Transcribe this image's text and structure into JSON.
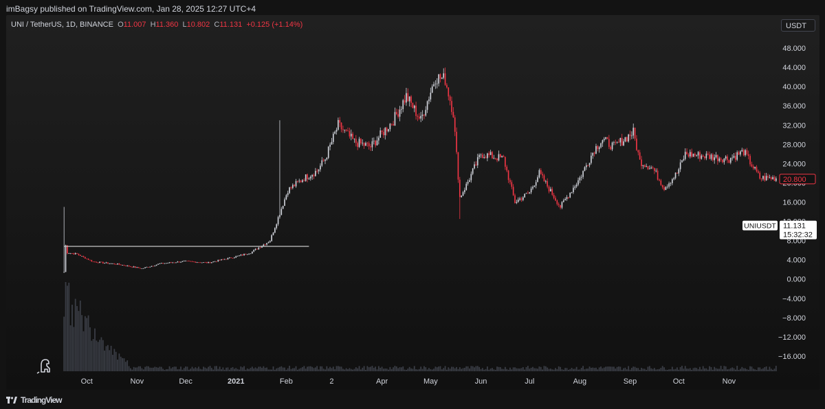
{
  "header": {
    "published_line": "imBagsy published on TradingView.com, Jan 28, 2025 12:27 UTC+4"
  },
  "legend": {
    "symbol": "UNI / TetherUS, 1D, BINANCE",
    "open_label": "O",
    "open": "11.007",
    "high_label": "H",
    "high": "11.360",
    "low_label": "L",
    "low": "10.802",
    "close_label": "C",
    "close": "11.131",
    "change": "+0.125 (+1.14%)"
  },
  "currency_button": "USDT",
  "footer": {
    "brand": "TradingView",
    "logo_icon": "tradingview-logo-icon"
  },
  "colors": {
    "up": "#d1d4dc",
    "down": "#f23645",
    "price_tag_border": "#f23645",
    "volume": "#3a3d45",
    "horizontal_line": "#c8c8c8"
  },
  "chart_data": {
    "type": "candlestick",
    "symbol": "UNIUSDT",
    "timeframe": "1D",
    "y_axis": {
      "ticks": [
        "48.000",
        "44.000",
        "40.000",
        "36.000",
        "32.000",
        "28.000",
        "24.000",
        "20.000",
        "16.000",
        "12.000",
        "8.000",
        "4.000",
        "0.000",
        "−4.000",
        "−8.000",
        "−12.000",
        "−16.000"
      ],
      "tick_values": [
        48,
        44,
        40,
        36,
        32,
        28,
        24,
        20,
        16,
        12,
        8,
        4,
        0,
        -4,
        -8,
        -12,
        -16
      ],
      "ylim": [
        -19,
        50
      ]
    },
    "x_axis": {
      "ticks": [
        "Oct",
        "Nov",
        "Dec",
        "2021",
        "Feb",
        "2",
        "Apr",
        "May",
        "Jun",
        "Jul",
        "Aug",
        "Sep",
        "Oct",
        "Nov"
      ],
      "bold": [
        "2021"
      ]
    },
    "series_start": "2020-09-17",
    "series_end": "2021-11-30",
    "price_path_anchors": [
      [
        "2020-09-17",
        1.5
      ],
      [
        "2020-09-18",
        7.0
      ],
      [
        "2020-09-19",
        5.5
      ],
      [
        "2020-09-25",
        5.2
      ],
      [
        "2020-10-05",
        3.6
      ],
      [
        "2020-10-20",
        3.1
      ],
      [
        "2020-11-04",
        2.2
      ],
      [
        "2020-11-15",
        3.2
      ],
      [
        "2020-11-30",
        3.7
      ],
      [
        "2020-12-15",
        3.4
      ],
      [
        "2020-12-31",
        4.6
      ],
      [
        "2021-01-10",
        5.5
      ],
      [
        "2021-01-22",
        8.0
      ],
      [
        "2021-02-02",
        18.5
      ],
      [
        "2021-02-12",
        21.0
      ],
      [
        "2021-02-20",
        22.5
      ],
      [
        "2021-02-25",
        25.0
      ],
      [
        "2021-03-05",
        32.0
      ],
      [
        "2021-03-15",
        28.5
      ],
      [
        "2021-03-25",
        27.5
      ],
      [
        "2021-04-08",
        33.0
      ],
      [
        "2021-04-16",
        38.0
      ],
      [
        "2021-04-25",
        33.0
      ],
      [
        "2021-05-04",
        42.0
      ],
      [
        "2021-05-10",
        41.5
      ],
      [
        "2021-05-15",
        34.5
      ],
      [
        "2021-05-19",
        17.0
      ],
      [
        "2021-05-23",
        19.5
      ],
      [
        "2021-06-01",
        26.0
      ],
      [
        "2021-06-15",
        25.0
      ],
      [
        "2021-06-22",
        16.0
      ],
      [
        "2021-07-01",
        18.0
      ],
      [
        "2021-07-07",
        22.0
      ],
      [
        "2021-07-20",
        15.0
      ],
      [
        "2021-08-01",
        21.0
      ],
      [
        "2021-08-10",
        27.0
      ],
      [
        "2021-08-15",
        29.0
      ],
      [
        "2021-08-22",
        27.5
      ],
      [
        "2021-09-03",
        30.5
      ],
      [
        "2021-09-07",
        24.5
      ],
      [
        "2021-09-15",
        23.0
      ],
      [
        "2021-09-22",
        19.0
      ],
      [
        "2021-09-30",
        22.0
      ],
      [
        "2021-10-05",
        26.0
      ],
      [
        "2021-10-20",
        25.5
      ],
      [
        "2021-11-01",
        25.0
      ],
      [
        "2021-11-10",
        26.5
      ],
      [
        "2021-11-20",
        21.0
      ],
      [
        "2021-11-30",
        21.0
      ]
    ],
    "spikes": [
      {
        "date": "2020-09-17",
        "high": 15.0
      },
      {
        "date": "2021-05-19",
        "low": 12.5
      },
      {
        "date": "2021-01-28",
        "high": 33.0
      }
    ],
    "horizontal_line": {
      "price": 6.8,
      "from": "2020-09-17",
      "to": "2021-02-15"
    },
    "price_tags": [
      {
        "label": "20.800",
        "value": 20.8,
        "style": "outline-red"
      },
      {
        "label": "11.131",
        "sublabel": "15:32:32",
        "value": 11.131,
        "style": "white"
      }
    ],
    "symbol_tag": "UNIUSDT",
    "volume": {
      "shown": true,
      "spike_date": "2020-09-18"
    }
  }
}
